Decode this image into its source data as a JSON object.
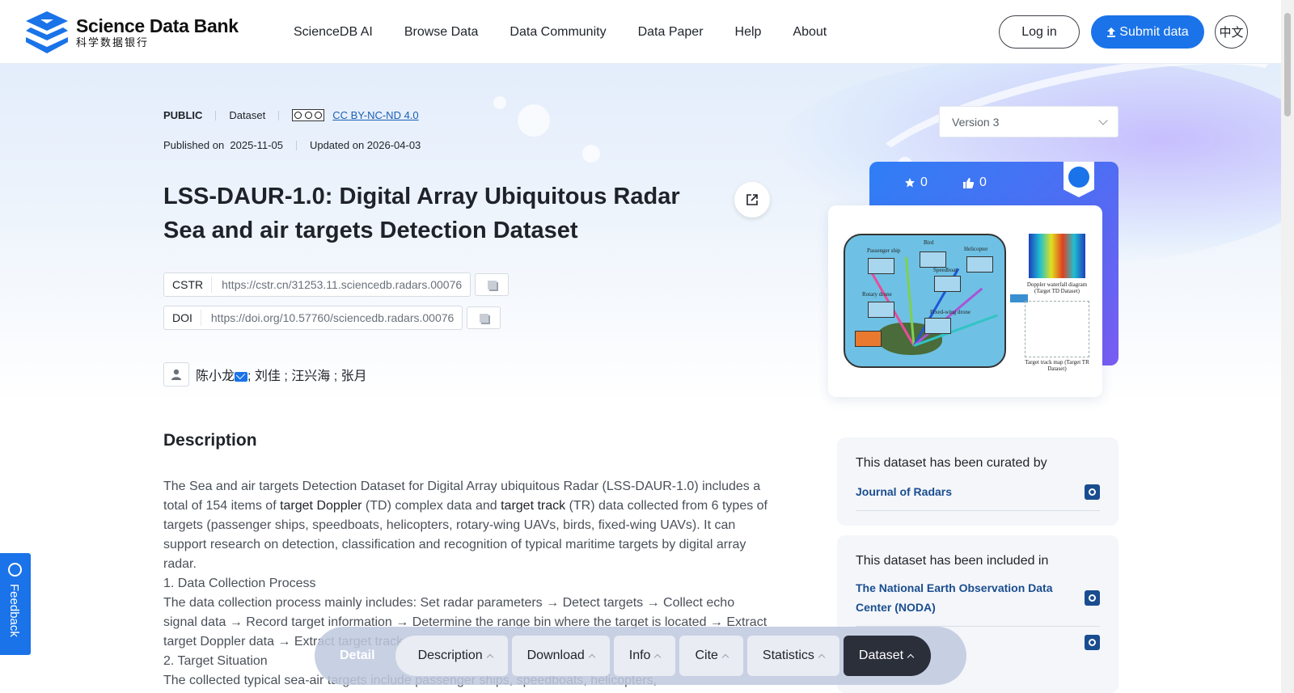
{
  "header": {
    "logo_en": "Science Data Bank",
    "logo_cn": "科学数据银行",
    "nav": [
      "ScienceDB AI",
      "Browse Data",
      "Data Community",
      "Data Paper",
      "Help",
      "About"
    ],
    "login": "Log in",
    "submit": "Submit data",
    "lang": "中文"
  },
  "meta": {
    "visibility": "PUBLIC",
    "type": "Dataset",
    "license": "CC BY-NC-ND 4.0",
    "published_label": "Published on",
    "published_date": "2025-11-05",
    "updated": "Updated on 2026-04-03"
  },
  "title": "LSS-DAUR-1.0: Digital Array Ubiquitous Radar Sea and air targets Detection Dataset",
  "identifiers": {
    "cstr_label": "CSTR",
    "cstr_value": "https://cstr.cn/31253.11.sciencedb.radars.00076",
    "doi_label": "DOI",
    "doi_value": "https://doi.org/10.57760/sciencedb.radars.00076"
  },
  "authors": {
    "first": "陈小龙",
    "rest": "; 刘佳 ; 汪兴海 ; 张月"
  },
  "description": {
    "heading": "Description",
    "p1_a": "The Sea and air targets Detection Dataset for Digital Array ubiquitous Radar (LSS-DAUR-1.0) includes a total of 154 items of ",
    "p1_b": "target Doppler",
    "p1_c": " (TD) complex data and ",
    "p1_d": "target track",
    "p1_e": " (TR) data collected from 6 types of targets (passenger ships, speedboats, helicopters, rotary-wing UAVs, birds, fixed-wing UAVs). It can support research on detection, classification and recognition of typical maritime targets by digital array radar.",
    "p2": "1. Data Collection Process",
    "p3": "The data collection process mainly includes: Set radar parameters → Detect targets → Collect echo signal data → Record target information → Determine the range bin where the target is located → Extract target Doppler data → Extract target track data",
    "p4": "2. Target Situation",
    "p5": "The collected typical sea-air targets include passenger ships, speedboats, helicopters,"
  },
  "sidebar": {
    "version": "Version 3",
    "stars": "0",
    "likes": "0",
    "curated_heading": "This dataset has been curated by",
    "curated_by": "Journal of Radars",
    "included_heading": "This dataset has been included in",
    "included_in": "The National Earth Observation Data Center (NODA)"
  },
  "preview_captions": {
    "passenger": "Passenger ship",
    "bird": "Bird",
    "helicopter": "Helicopter",
    "speedboat": "Speedboat",
    "rotary": "Rotary drone",
    "fixedwing": "Fixed-wing drone",
    "doppler": "Doppler waterfall diagram (Target TD Dataset)",
    "track": "Target track map (Target TR Dataset)"
  },
  "feedback": "Feedback",
  "bottom_nav": {
    "detail": "Detail",
    "items": [
      "Description",
      "Download",
      "Info",
      "Cite",
      "Statistics",
      "Dataset"
    ]
  },
  "colors": {
    "brand": "#1a73e8",
    "link": "#1a4d8f",
    "active_tab": "#2a2f3a"
  }
}
